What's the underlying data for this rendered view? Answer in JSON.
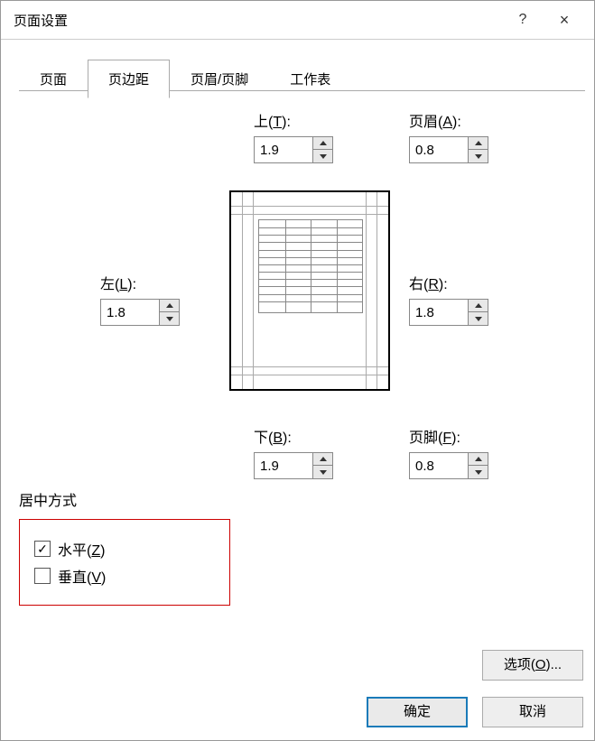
{
  "title": "页面设置",
  "titlebar": {
    "help": "?",
    "close": "×"
  },
  "tabs": [
    {
      "label": "页面"
    },
    {
      "label": "页边距",
      "active": true
    },
    {
      "label": "页眉/页脚"
    },
    {
      "label": "工作表"
    }
  ],
  "margins": {
    "top": {
      "label_prefix": "上(",
      "key": "T",
      "label_suffix": "):",
      "value": "1.9"
    },
    "header": {
      "label_prefix": "页眉(",
      "key": "A",
      "label_suffix": "):",
      "value": "0.8"
    },
    "left": {
      "label_prefix": "左(",
      "key": "L",
      "label_suffix": "):",
      "value": "1.8"
    },
    "right": {
      "label_prefix": "右(",
      "key": "R",
      "label_suffix": "):",
      "value": "1.8"
    },
    "bottom": {
      "label_prefix": "下(",
      "key": "B",
      "label_suffix": "):",
      "value": "1.9"
    },
    "footer": {
      "label_prefix": "页脚(",
      "key": "F",
      "label_suffix": "):",
      "value": "0.8"
    }
  },
  "center": {
    "title": "居中方式",
    "horizontal": {
      "label_prefix": "水平(",
      "key": "Z",
      "label_suffix": ")",
      "checked": true
    },
    "vertical": {
      "label_prefix": "垂直(",
      "key": "V",
      "label_suffix": ")",
      "checked": false
    }
  },
  "buttons": {
    "options_prefix": "选项(",
    "options_key": "O",
    "options_suffix": ")...",
    "ok": "确定",
    "cancel": "取消"
  }
}
